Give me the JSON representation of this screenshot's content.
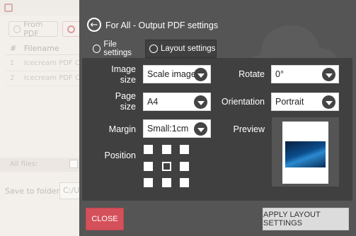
{
  "background_app": {
    "tab_from_label": "From PDF",
    "table_headers": [
      "#",
      "Filename"
    ],
    "rows": [
      {
        "index": "1",
        "filename": "Icecream PDF Co"
      },
      {
        "index": "2",
        "filename": "Icecream PDF Co"
      }
    ],
    "all_files_label": "All files:",
    "save_to_folder_label": "Save to folder:",
    "save_to_folder_value": "C:/Us"
  },
  "panel": {
    "title": "For All - Output PDF settings",
    "tabs": [
      {
        "label": "File settings",
        "icon": "document-icon",
        "active": false
      },
      {
        "label": "Layout settings",
        "icon": "layout-icon",
        "active": true
      }
    ]
  },
  "layout": {
    "image_size": {
      "label_line1": "Image",
      "label_line2": "size",
      "value": "Scale image"
    },
    "rotate": {
      "label": "Rotate",
      "value": "0°"
    },
    "page_size": {
      "label_line1": "Page",
      "label_line2": "size",
      "value": "A4"
    },
    "orientation": {
      "label": "Orientation",
      "value": "Portrait"
    },
    "margin": {
      "label": "Margin",
      "value": "Small:1cm"
    },
    "preview_label": "Preview",
    "position_label": "Position",
    "position_selected": "center"
  },
  "footer": {
    "close_label": "CLOSE",
    "apply_label": "APPLY LAYOUT SETTINGS"
  },
  "colors": {
    "panel_bg": "#555555",
    "content_bg": "#404040",
    "close_button": "#d4505a",
    "apply_button": "#dcdcdc"
  }
}
